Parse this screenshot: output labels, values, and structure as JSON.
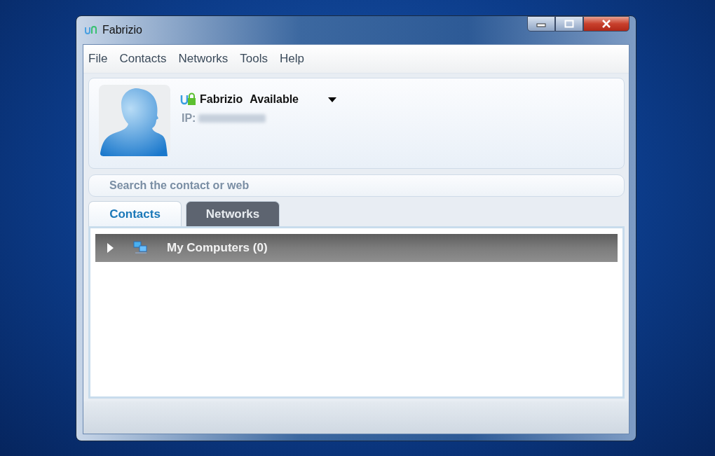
{
  "window": {
    "title": "Fabrizio"
  },
  "menu": [
    "File",
    "Contacts",
    "Networks",
    "Tools",
    "Help"
  ],
  "profile": {
    "name": "Fabrizio",
    "status": "Available",
    "ip_label": "IP:"
  },
  "search": {
    "placeholder": "Search the contact or web"
  },
  "tabs": [
    {
      "label": "Contacts",
      "selected": true
    },
    {
      "label": "Networks",
      "selected": false
    }
  ],
  "groups": [
    {
      "label": "My Computers (0)",
      "expanded": false
    }
  ]
}
